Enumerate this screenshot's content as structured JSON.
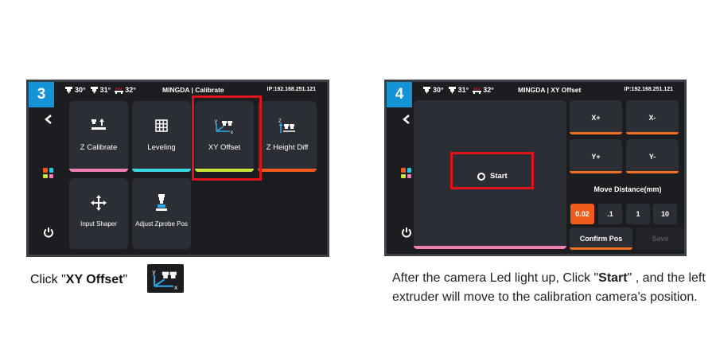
{
  "colors": {
    "panel_bg": "#1c1d21",
    "tile_bg": "#2b2e35",
    "badge": "#1493d6",
    "highlight": "#e0121a",
    "accent_orange": "#f07020",
    "pink": "#f07db3",
    "cyan": "#38d6e0",
    "lime": "#c8e63c",
    "orange": "#f05a1a"
  },
  "step3": {
    "badge": "3",
    "temps": [
      "30°",
      "31°",
      "32°"
    ],
    "title": "MINGDA | Calibrate",
    "ip": "IP:192.168.251.121",
    "tiles": [
      {
        "label": "Z Calibrate",
        "icon": "z-calibrate-icon",
        "bar_color": "#f07db3"
      },
      {
        "label": "Leveling",
        "icon": "grid-icon",
        "bar_color": "#38d6e0"
      },
      {
        "label": "XY Offset",
        "icon": "xy-offset-icon",
        "bar_color": "#c8e63c"
      },
      {
        "label": "Z Height Diff",
        "icon": "z-height-diff-icon",
        "bar_color": "#f05a1a"
      },
      {
        "label": "Input Shaper",
        "icon": "move-arrows-icon",
        "bar_color": "#f07db3"
      },
      {
        "label": "Adjust Zprobe Pos",
        "icon": "zprobe-icon",
        "bar_color": "#38d6e0"
      }
    ]
  },
  "step4": {
    "badge": "4",
    "temps": [
      "30°",
      "31°",
      "32°"
    ],
    "title": "MINGDA | XY Offset",
    "ip": "IP:192.168.251.121",
    "start_label": "Start",
    "buttons": {
      "x_plus": "X+",
      "x_minus": "X-",
      "y_plus": "Y+",
      "y_minus": "Y-"
    },
    "move_distance_label": "Move Distance(mm)",
    "distances": [
      "0.02",
      ".1",
      "1",
      "10"
    ],
    "selected_distance": "0.02",
    "confirm_label": "Confirm Pos",
    "save_label": "Save"
  },
  "captions": {
    "caption1_prefix": "Click \"",
    "caption1_bold": "XY Offset",
    "caption1_suffix": "\"",
    "caption2_prefix": "After the camera Led light up, Click \"",
    "caption2_bold": "Start",
    "caption2_suffix": "\" , and the left extruder will move to the calibration camera's position."
  }
}
